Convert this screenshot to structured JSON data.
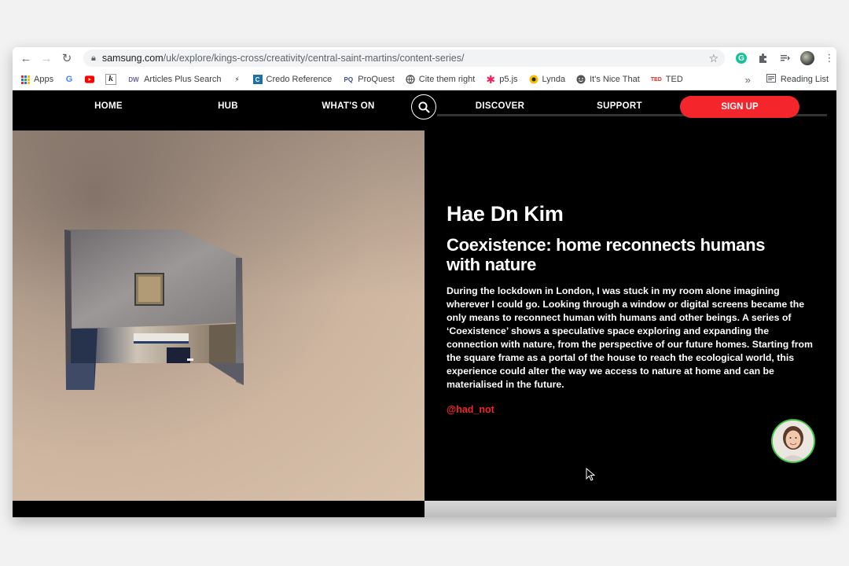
{
  "browser": {
    "url_host": "samsung.com",
    "url_path": "/uk/explore/kings-cross/creativity/central-saint-martins/content-series/",
    "bookmarks": [
      {
        "label": "Apps",
        "icon": "apps-grid-icon"
      },
      {
        "label": "",
        "icon": "google-icon"
      },
      {
        "label": "",
        "icon": "youtube-icon"
      },
      {
        "label": "",
        "icon": "k-icon"
      },
      {
        "label": "Articles Plus Search",
        "icon": "dw-icon"
      },
      {
        "label": "",
        "icon": "bolt-icon"
      },
      {
        "label": "Credo Reference",
        "icon": "credo-icon"
      },
      {
        "label": "ProQuest",
        "icon": "proquest-icon"
      },
      {
        "label": "Cite them right",
        "icon": "globe-icon"
      },
      {
        "label": "p5.js",
        "icon": "asterisk-icon"
      },
      {
        "label": "Lynda",
        "icon": "lynda-icon"
      },
      {
        "label": "It's Nice That",
        "icon": "smiley-icon"
      },
      {
        "label": "TED",
        "icon": "ted-icon"
      }
    ],
    "overflow": "»",
    "reading_list": "Reading List"
  },
  "site": {
    "nav": {
      "home": "HOME",
      "hub": "HUB",
      "whats_on": "WHAT'S ON",
      "discover": "DISCOVER",
      "support": "SUPPORT",
      "sign_up": "SIGN UP"
    },
    "artist_name": "Hae Dn Kim",
    "work_title": "Coexistence: home reconnects humans with nature",
    "description": "During the lockdown in London, I was stuck in my room alone imagining wherever I could go. Looking through a window or digital screens became the only means to reconnect human with humans and other beings. A series of ‘Coexistence’ shows a speculative space exploring and expanding the connection with nature, from the perspective of our future homes. Starting from the square frame as a portal of the house to reach the ecological world, this experience could alter the way we access to nature at home and can be materialised in the future.",
    "handle": "@had_not"
  },
  "colors": {
    "accent_red": "#f4252b",
    "page_bg": "#000000",
    "avatar_ring": "#3ec63e"
  }
}
